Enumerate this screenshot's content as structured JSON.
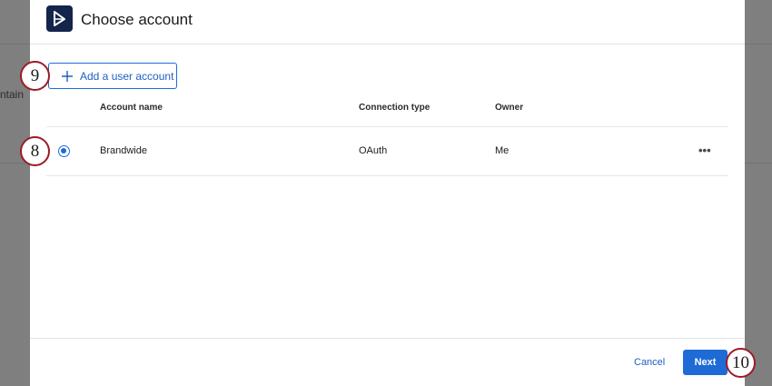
{
  "background": {
    "partial_text": "ntain"
  },
  "dialog": {
    "title": "Choose account",
    "add_button_label": "Add a user account",
    "columns": [
      "Account name",
      "Connection type",
      "Owner"
    ],
    "rows": [
      {
        "account_name": "Brandwide",
        "connection_type": "OAuth",
        "owner": "Me",
        "selected": true
      }
    ],
    "more_label": "•••",
    "cancel_label": "Cancel",
    "next_label": "Next"
  },
  "markers": [
    "9",
    "8",
    "10"
  ],
  "colors": {
    "accent": "#1e6bd6",
    "logo_bg": "#14244a",
    "marker_border": "#9c1a26"
  }
}
